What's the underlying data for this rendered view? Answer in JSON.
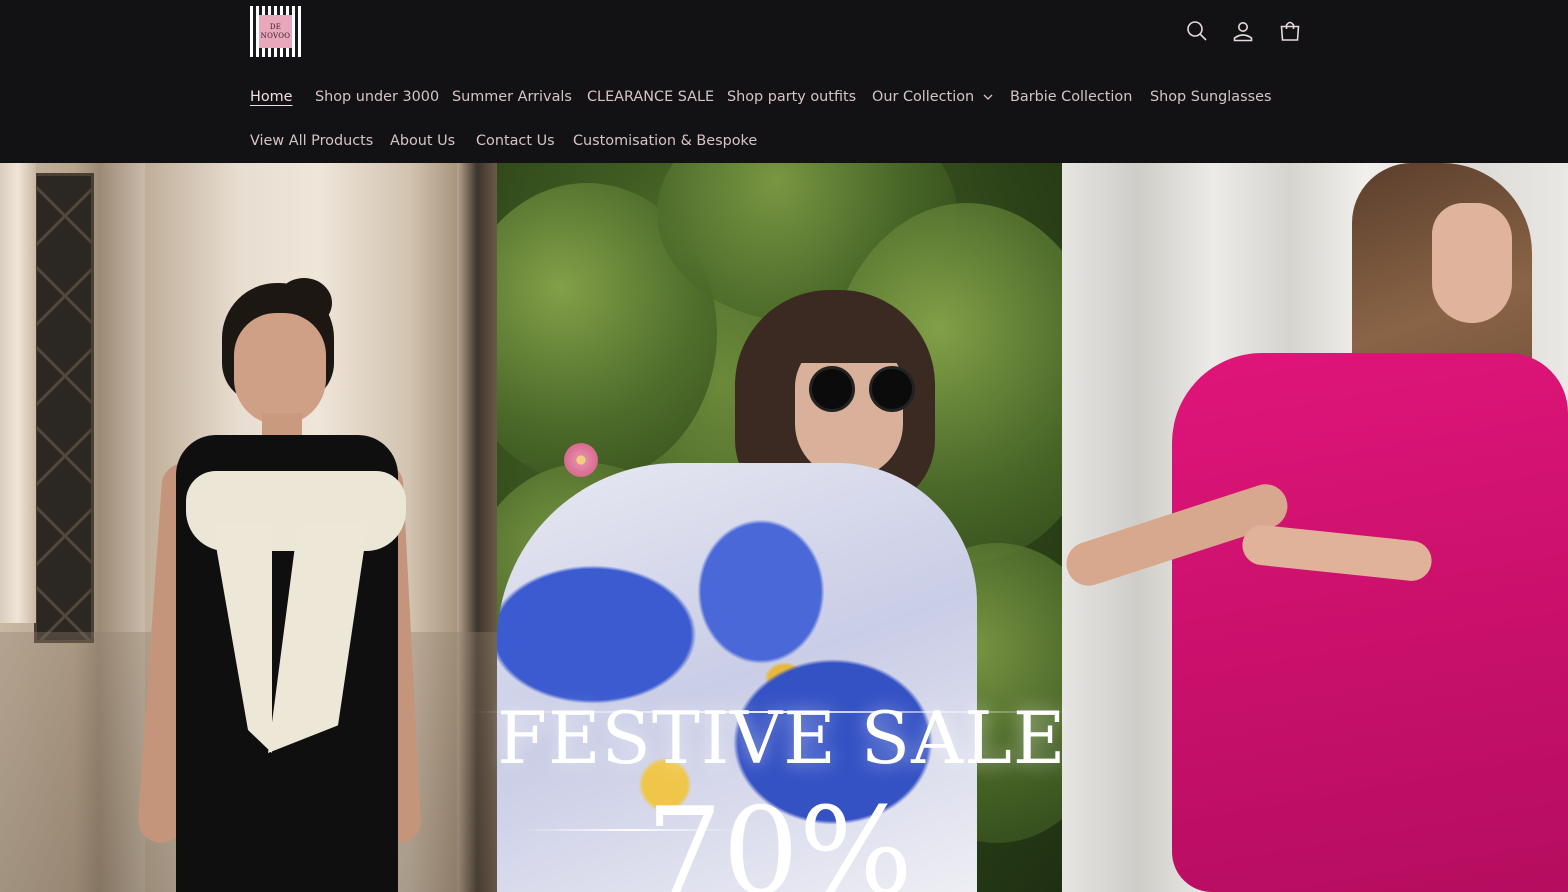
{
  "brand": {
    "logo_lines": [
      "DE",
      "NOVOO"
    ]
  },
  "header_icons": [
    "search-icon",
    "account-icon",
    "cart-icon"
  ],
  "nav": {
    "row1": [
      {
        "label": "Home",
        "active": true
      },
      {
        "label": "Shop under 3000"
      },
      {
        "label": "Summer Arrivals"
      },
      {
        "label": "CLEARANCE SALE"
      },
      {
        "label": "Shop party outfits"
      },
      {
        "label": "Our Collection",
        "dropdown": true
      },
      {
        "label": "Barbie Collection"
      },
      {
        "label": "Shop Sunglasses"
      }
    ],
    "row2": [
      {
        "label": "View All Products"
      },
      {
        "label": "About Us"
      },
      {
        "label": "Contact Us"
      },
      {
        "label": "Customisation & Bespoke"
      }
    ]
  },
  "hero": {
    "headline": "FESTIVE SALE",
    "subline": "70%"
  },
  "colors": {
    "header_bg": "#121214",
    "nav_text": "#d7c3c6",
    "pink_dress": "#e0157a"
  }
}
